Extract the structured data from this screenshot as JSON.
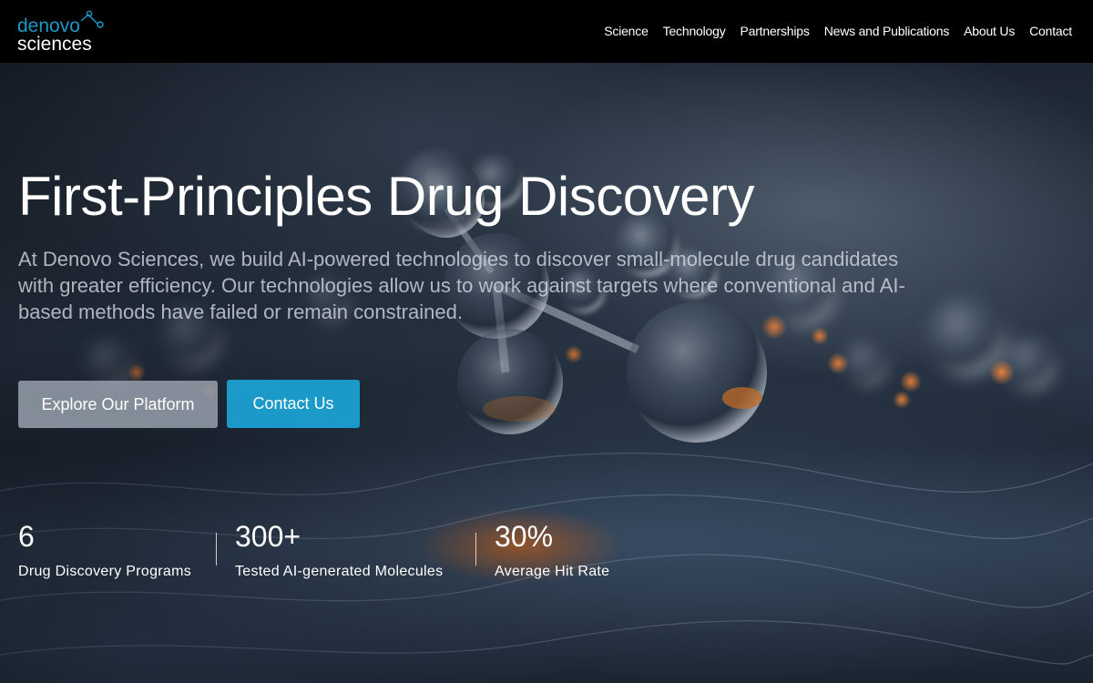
{
  "brand": {
    "logo_line1": "denovo",
    "logo_line2": "sciences",
    "accent_color": "#1b9ac9"
  },
  "nav": {
    "items": [
      {
        "label": "Science"
      },
      {
        "label": "Technology"
      },
      {
        "label": "Partnerships"
      },
      {
        "label": "News and Publications"
      },
      {
        "label": "About Us"
      },
      {
        "label": "Contact"
      }
    ]
  },
  "hero": {
    "title": "First-Principles Drug Discovery",
    "description": "At Denovo Sciences, we build AI-powered technologies to discover small-molecule drug candidates with greater efficiency. Our technologies allow us to work against targets where conventional and AI-based methods have failed or remain constrained.",
    "primary_button": "Explore Our Platform",
    "secondary_button": "Contact Us"
  },
  "stats": [
    {
      "value": "6",
      "label": "Drug Discovery Programs"
    },
    {
      "value": "300+",
      "label": "Tested AI-generated Molecules"
    },
    {
      "value": "30%",
      "label": "Average Hit Rate"
    }
  ]
}
